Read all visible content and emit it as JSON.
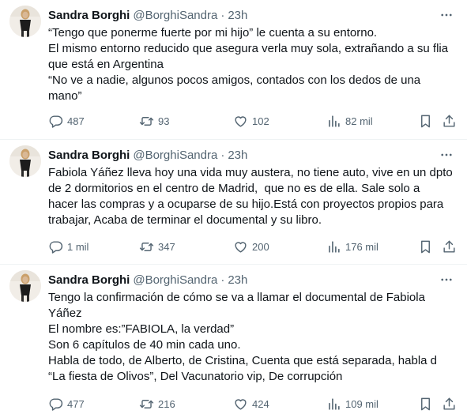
{
  "tweets": [
    {
      "author": "Sandra Borghi",
      "handle": "@BorghiSandra",
      "separator": "·",
      "time": "23h",
      "lines": [
        "“Tengo que ponerme fuerte por mi hijo” le cuenta a su entorno.",
        "El mismo entorno reducido que asegura verla muy sola, extrañando a su flia",
        "que está en Argentina",
        "“No ve a nadie, algunos pocos amigos, contados con los dedos de una",
        "mano”"
      ],
      "replies": "487",
      "retweets": "93",
      "likes": "102",
      "views": "82 mil"
    },
    {
      "author": "Sandra Borghi",
      "handle": "@BorghiSandra",
      "separator": "·",
      "time": "23h",
      "lines": [
        "Fabiola Yáñez lleva hoy una vida muy austera, no tiene auto, vive en un dpto",
        "de 2 dormitorios en el centro de Madrid,  que no es de ella. Sale solo a",
        "hacer las compras y a ocuparse de su hijo.Está con proyectos propios para",
        "trabajar, Acaba de terminar el documental y su libro."
      ],
      "replies": "1 mil",
      "retweets": "347",
      "likes": "200",
      "views": "176 mil"
    },
    {
      "author": "Sandra Borghi",
      "handle": "@BorghiSandra",
      "separator": "·",
      "time": "23h",
      "lines": [
        "Tengo la confirmación de cómo se va a llamar el documental de Fabiola",
        "Yáñez",
        "El nombre es:”FABIOLA, la verdad”",
        "Son 6 capítulos de 40 min cada uno.",
        "Habla de todo, de Alberto, de Cristina, Cuenta que está separada, habla d",
        "“La fiesta de Olivos”, Del Vacunatorio vip, De corrupción"
      ],
      "replies": "477",
      "retweets": "216",
      "likes": "424",
      "views": "109 mil"
    }
  ],
  "icons": {
    "reply": "reply-icon",
    "retweet": "retweet-icon",
    "like": "like-icon",
    "views": "views-icon",
    "bookmark": "bookmark-icon",
    "share": "share-icon",
    "more": "more-icon"
  },
  "colors": {
    "text": "#0f1419",
    "secondary": "#536471",
    "divider": "#eff3f4"
  }
}
